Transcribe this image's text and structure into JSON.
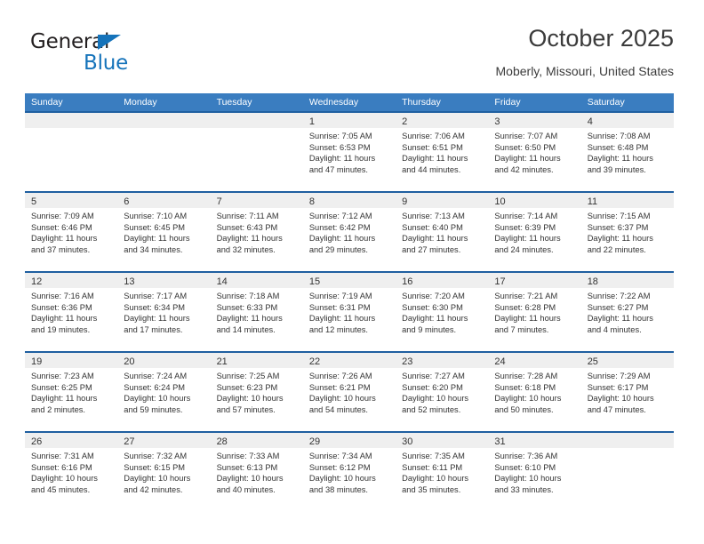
{
  "brand": {
    "name_part1": "General",
    "name_part2": "Blue",
    "triangle_icon": "triangle-icon",
    "color_primary": "#1573ba",
    "color_text": "#231f20"
  },
  "header": {
    "title": "October 2025",
    "subtitle": "Moberly, Missouri, United States"
  },
  "theme": {
    "header_row_bg": "#3a7dc0",
    "row_border": "#1f5fa0",
    "day_band_bg": "#efefef",
    "text": "#333333"
  },
  "weekdays": [
    "Sunday",
    "Monday",
    "Tuesday",
    "Wednesday",
    "Thursday",
    "Friday",
    "Saturday"
  ],
  "weeks": [
    [
      {
        "day": "",
        "empty": true
      },
      {
        "day": "",
        "empty": true
      },
      {
        "day": "",
        "empty": true
      },
      {
        "day": "1",
        "sunrise": "Sunrise: 7:05 AM",
        "sunset": "Sunset: 6:53 PM",
        "daylight": "Daylight: 11 hours and 47 minutes."
      },
      {
        "day": "2",
        "sunrise": "Sunrise: 7:06 AM",
        "sunset": "Sunset: 6:51 PM",
        "daylight": "Daylight: 11 hours and 44 minutes."
      },
      {
        "day": "3",
        "sunrise": "Sunrise: 7:07 AM",
        "sunset": "Sunset: 6:50 PM",
        "daylight": "Daylight: 11 hours and 42 minutes."
      },
      {
        "day": "4",
        "sunrise": "Sunrise: 7:08 AM",
        "sunset": "Sunset: 6:48 PM",
        "daylight": "Daylight: 11 hours and 39 minutes."
      }
    ],
    [
      {
        "day": "5",
        "sunrise": "Sunrise: 7:09 AM",
        "sunset": "Sunset: 6:46 PM",
        "daylight": "Daylight: 11 hours and 37 minutes."
      },
      {
        "day": "6",
        "sunrise": "Sunrise: 7:10 AM",
        "sunset": "Sunset: 6:45 PM",
        "daylight": "Daylight: 11 hours and 34 minutes."
      },
      {
        "day": "7",
        "sunrise": "Sunrise: 7:11 AM",
        "sunset": "Sunset: 6:43 PM",
        "daylight": "Daylight: 11 hours and 32 minutes."
      },
      {
        "day": "8",
        "sunrise": "Sunrise: 7:12 AM",
        "sunset": "Sunset: 6:42 PM",
        "daylight": "Daylight: 11 hours and 29 minutes."
      },
      {
        "day": "9",
        "sunrise": "Sunrise: 7:13 AM",
        "sunset": "Sunset: 6:40 PM",
        "daylight": "Daylight: 11 hours and 27 minutes."
      },
      {
        "day": "10",
        "sunrise": "Sunrise: 7:14 AM",
        "sunset": "Sunset: 6:39 PM",
        "daylight": "Daylight: 11 hours and 24 minutes."
      },
      {
        "day": "11",
        "sunrise": "Sunrise: 7:15 AM",
        "sunset": "Sunset: 6:37 PM",
        "daylight": "Daylight: 11 hours and 22 minutes."
      }
    ],
    [
      {
        "day": "12",
        "sunrise": "Sunrise: 7:16 AM",
        "sunset": "Sunset: 6:36 PM",
        "daylight": "Daylight: 11 hours and 19 minutes."
      },
      {
        "day": "13",
        "sunrise": "Sunrise: 7:17 AM",
        "sunset": "Sunset: 6:34 PM",
        "daylight": "Daylight: 11 hours and 17 minutes."
      },
      {
        "day": "14",
        "sunrise": "Sunrise: 7:18 AM",
        "sunset": "Sunset: 6:33 PM",
        "daylight": "Daylight: 11 hours and 14 minutes."
      },
      {
        "day": "15",
        "sunrise": "Sunrise: 7:19 AM",
        "sunset": "Sunset: 6:31 PM",
        "daylight": "Daylight: 11 hours and 12 minutes."
      },
      {
        "day": "16",
        "sunrise": "Sunrise: 7:20 AM",
        "sunset": "Sunset: 6:30 PM",
        "daylight": "Daylight: 11 hours and 9 minutes."
      },
      {
        "day": "17",
        "sunrise": "Sunrise: 7:21 AM",
        "sunset": "Sunset: 6:28 PM",
        "daylight": "Daylight: 11 hours and 7 minutes."
      },
      {
        "day": "18",
        "sunrise": "Sunrise: 7:22 AM",
        "sunset": "Sunset: 6:27 PM",
        "daylight": "Daylight: 11 hours and 4 minutes."
      }
    ],
    [
      {
        "day": "19",
        "sunrise": "Sunrise: 7:23 AM",
        "sunset": "Sunset: 6:25 PM",
        "daylight": "Daylight: 11 hours and 2 minutes."
      },
      {
        "day": "20",
        "sunrise": "Sunrise: 7:24 AM",
        "sunset": "Sunset: 6:24 PM",
        "daylight": "Daylight: 10 hours and 59 minutes."
      },
      {
        "day": "21",
        "sunrise": "Sunrise: 7:25 AM",
        "sunset": "Sunset: 6:23 PM",
        "daylight": "Daylight: 10 hours and 57 minutes."
      },
      {
        "day": "22",
        "sunrise": "Sunrise: 7:26 AM",
        "sunset": "Sunset: 6:21 PM",
        "daylight": "Daylight: 10 hours and 54 minutes."
      },
      {
        "day": "23",
        "sunrise": "Sunrise: 7:27 AM",
        "sunset": "Sunset: 6:20 PM",
        "daylight": "Daylight: 10 hours and 52 minutes."
      },
      {
        "day": "24",
        "sunrise": "Sunrise: 7:28 AM",
        "sunset": "Sunset: 6:18 PM",
        "daylight": "Daylight: 10 hours and 50 minutes."
      },
      {
        "day": "25",
        "sunrise": "Sunrise: 7:29 AM",
        "sunset": "Sunset: 6:17 PM",
        "daylight": "Daylight: 10 hours and 47 minutes."
      }
    ],
    [
      {
        "day": "26",
        "sunrise": "Sunrise: 7:31 AM",
        "sunset": "Sunset: 6:16 PM",
        "daylight": "Daylight: 10 hours and 45 minutes."
      },
      {
        "day": "27",
        "sunrise": "Sunrise: 7:32 AM",
        "sunset": "Sunset: 6:15 PM",
        "daylight": "Daylight: 10 hours and 42 minutes."
      },
      {
        "day": "28",
        "sunrise": "Sunrise: 7:33 AM",
        "sunset": "Sunset: 6:13 PM",
        "daylight": "Daylight: 10 hours and 40 minutes."
      },
      {
        "day": "29",
        "sunrise": "Sunrise: 7:34 AM",
        "sunset": "Sunset: 6:12 PM",
        "daylight": "Daylight: 10 hours and 38 minutes."
      },
      {
        "day": "30",
        "sunrise": "Sunrise: 7:35 AM",
        "sunset": "Sunset: 6:11 PM",
        "daylight": "Daylight: 10 hours and 35 minutes."
      },
      {
        "day": "31",
        "sunrise": "Sunrise: 7:36 AM",
        "sunset": "Sunset: 6:10 PM",
        "daylight": "Daylight: 10 hours and 33 minutes."
      },
      {
        "day": "",
        "empty": true
      }
    ]
  ]
}
